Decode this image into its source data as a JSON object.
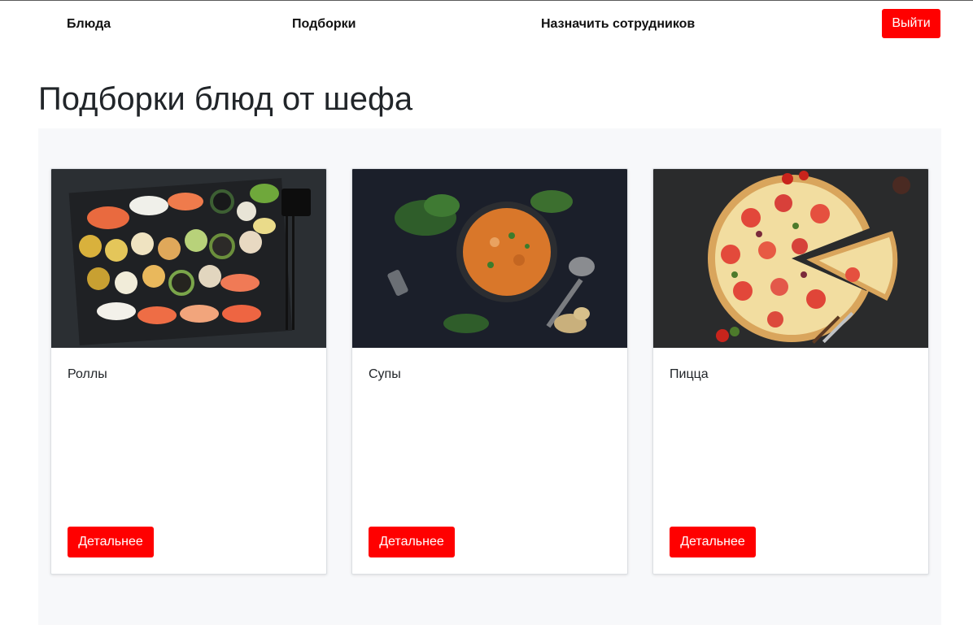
{
  "navbar": {
    "links": [
      {
        "label": "Блюда"
      },
      {
        "label": "Подборки"
      },
      {
        "label": "Назначить сотрудников"
      }
    ],
    "logout_label": "Выйти",
    "accent_color": "#ff0000"
  },
  "main": {
    "title": "Подборки блюд от шефа",
    "cards": [
      {
        "title": "Роллы",
        "image": "sushi-rolls-photo",
        "button_label": "Детальнее"
      },
      {
        "title": "Супы",
        "image": "soup-bowl-photo",
        "button_label": "Детальнее"
      },
      {
        "title": "Пицца",
        "image": "pizza-photo",
        "button_label": "Детальнее"
      }
    ]
  }
}
